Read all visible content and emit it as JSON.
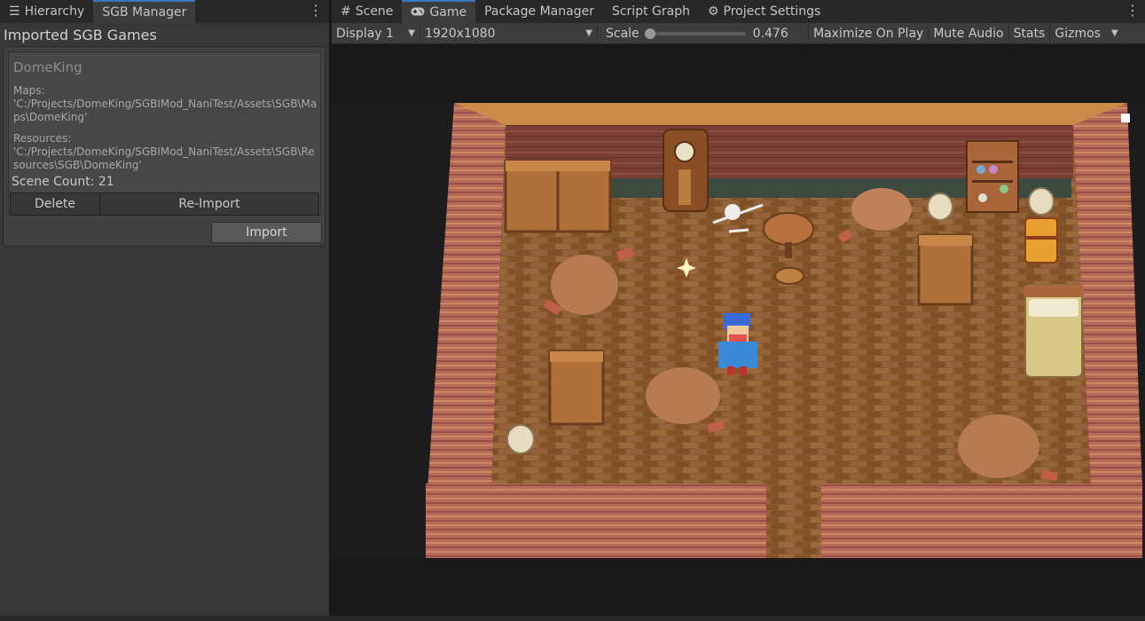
{
  "left_panel": {
    "tabs": [
      {
        "label": "Hierarchy",
        "icon": "list-icon"
      },
      {
        "label": "SGB Manager",
        "icon": ""
      }
    ],
    "menu_icon": "⋮",
    "heading": "Imported SGB Games",
    "games": [
      {
        "title": "DomeKing",
        "maps_label": "Maps:",
        "maps_path": "'C:/Projects/DomeKing/SGBIMod_NaniTest/Assets\\SGB\\Maps\\DomeKing'",
        "resources_label": "Resources:",
        "resources_path": "'C:/Projects/DomeKing/SGBIMod_NaniTest/Assets\\SGB\\Resources\\SGB\\DomeKing'",
        "scene_count": "Scene Count: 21",
        "delete_label": "Delete",
        "reimport_label": "Re-Import"
      }
    ],
    "import_label": "Import"
  },
  "right_panel": {
    "tabs": [
      {
        "label": "Scene",
        "icon": "grid-icon"
      },
      {
        "label": "Game",
        "icon": "gamepad-icon"
      },
      {
        "label": "Package Manager",
        "icon": ""
      },
      {
        "label": "Script Graph",
        "icon": ""
      },
      {
        "label": "Project Settings",
        "icon": "gear-icon"
      }
    ],
    "menu_icon": "⋮",
    "toolbar": {
      "display": "Display 1",
      "resolution": "1920x1080",
      "scale_label": "Scale",
      "scale_value": "0.476",
      "maximize": "Maximize On Play",
      "mute": "Mute Audio",
      "stats": "Stats",
      "gizmos": "Gizmos"
    }
  },
  "colors": {
    "accent": "#3a79bb",
    "panel_bg": "#383838",
    "dark_bg": "#191919",
    "floor": "#8a5a30",
    "wall": "#b46a5a"
  }
}
